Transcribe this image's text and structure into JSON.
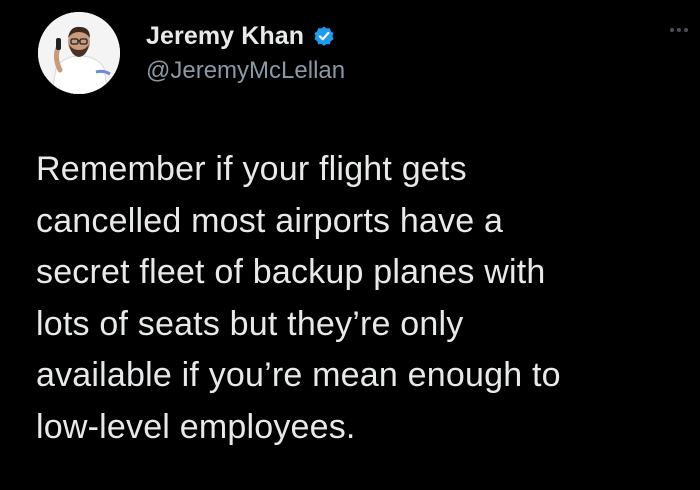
{
  "tweet": {
    "author": {
      "display_name": "Jeremy Khan",
      "handle": "@JeremyMcLellan",
      "verified": true
    },
    "text_lines": [
      "Remember if your flight gets",
      "cancelled most airports have a",
      "secret fleet of backup planes with",
      "lots of seats but they’re only",
      "available if you’re mean enough to",
      "low-level employees."
    ]
  },
  "colors": {
    "background": "#000000",
    "text": "#e7e9ea",
    "secondary_text": "#8b98a5",
    "verified_badge": "#1d9bf0"
  },
  "icons": {
    "verified": "verified-badge-icon",
    "more": "more-options-icon"
  }
}
